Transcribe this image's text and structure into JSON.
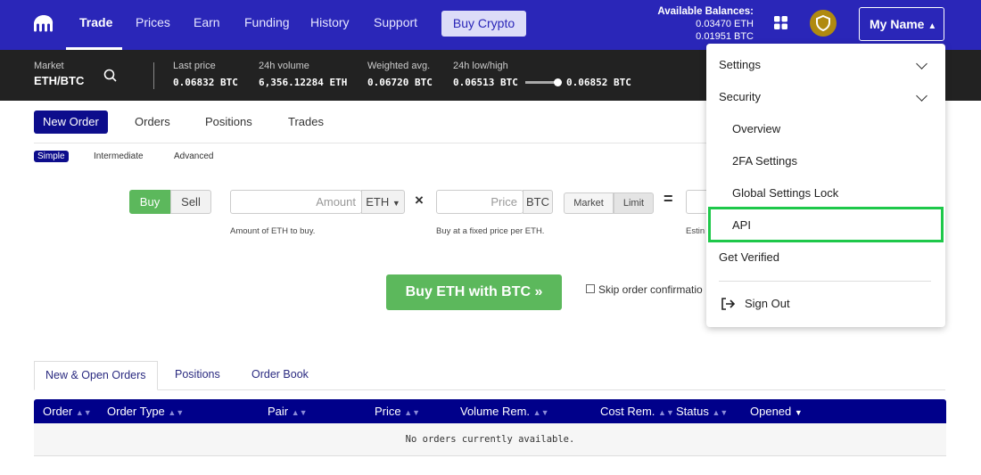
{
  "nav": {
    "items": [
      {
        "label": "Trade",
        "active": true
      },
      {
        "label": "Prices"
      },
      {
        "label": "Earn"
      },
      {
        "label": "Funding"
      },
      {
        "label": "History"
      },
      {
        "label": "Support"
      }
    ],
    "buy_crypto": "Buy Crypto"
  },
  "balances": {
    "title": "Available Balances:",
    "eth": "0.03470 ETH",
    "btc": "0.01951 BTC"
  },
  "user": {
    "name": "My Name"
  },
  "ticker": {
    "market_label": "Market",
    "market": "ETH/BTC",
    "last_label": "Last price",
    "last": "0.06832 BTC",
    "vol_label": "24h volume",
    "vol": "6,356.12284 ETH",
    "wavg_label": "Weighted avg.",
    "wavg": "0.06720 BTC",
    "lh_label": "24h low/high",
    "low": "0.06513 BTC",
    "high": "0.06852 BTC"
  },
  "tabs": [
    "New Order",
    "Orders",
    "Positions",
    "Trades"
  ],
  "subtabs": [
    "Simple",
    "Intermediate",
    "Advanced"
  ],
  "form": {
    "buy": "Buy",
    "sell": "Sell",
    "amount_placeholder": "Amount",
    "amount_unit": "ETH",
    "times": "×",
    "price_placeholder": "Price",
    "price_unit": "BTC",
    "market": "Market",
    "limit": "Limit",
    "equals": "=",
    "amount_hint": "Amount of ETH to buy.",
    "price_hint": "Buy at a fixed price per ETH.",
    "total_hint": "Estin",
    "submit": "Buy ETH with BTC »",
    "skip": "Skip order confirmatio"
  },
  "menu": {
    "settings": "Settings",
    "security": "Security",
    "overview": "Overview",
    "twofa": "2FA Settings",
    "lock": "Global Settings Lock",
    "api": "API",
    "verified": "Get Verified",
    "signout": "Sign Out",
    "highlight_color": "#1ec84a"
  },
  "orders": {
    "tabs": [
      "New & Open Orders",
      "Positions",
      "Order Book"
    ],
    "columns": [
      "Order",
      "Order Type",
      "Pair",
      "Price",
      "Volume Rem.",
      "Cost Rem.",
      "Status",
      "Opened"
    ],
    "empty": "No orders currently available."
  }
}
